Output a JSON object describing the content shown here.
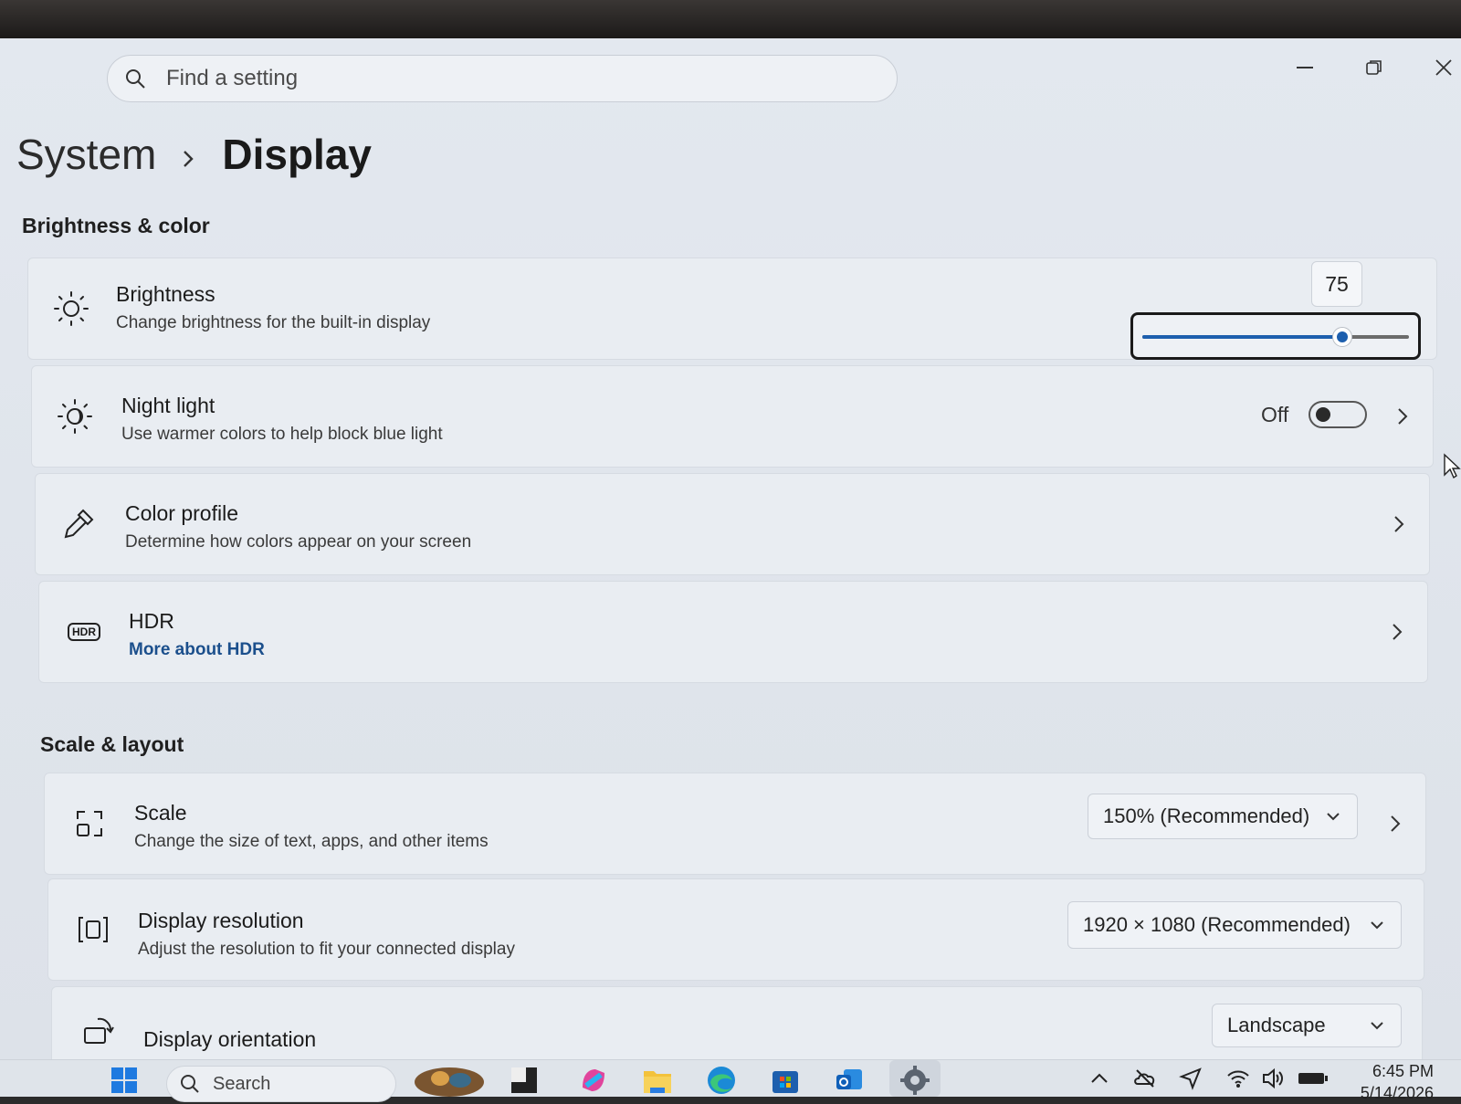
{
  "window": {
    "search_placeholder": "Find a setting",
    "controls": [
      "minimize",
      "restore",
      "close"
    ]
  },
  "breadcrumb": {
    "parent": "System",
    "separator": "›",
    "current": "Display"
  },
  "sections": {
    "brightness_color": "Brightness & color",
    "scale_layout": "Scale & layout"
  },
  "brightness": {
    "title": "Brightness",
    "subtitle": "Change brightness for the built-in display",
    "value": 75,
    "value_label": "75",
    "icon": "sun-icon"
  },
  "night_light": {
    "title": "Night light",
    "subtitle": "Use warmer colors to help block blue light",
    "state_label": "Off",
    "enabled": false,
    "icon": "night-light-icon"
  },
  "color_profile": {
    "title": "Color profile",
    "subtitle": "Determine how colors appear on your screen",
    "icon": "eyedropper-icon"
  },
  "hdr": {
    "title": "HDR",
    "link": "More about HDR",
    "icon_text": "HDR",
    "icon": "hdr-icon"
  },
  "scale": {
    "title": "Scale",
    "subtitle": "Change the size of text, apps, and other items",
    "selected": "150% (Recommended)",
    "icon": "scale-icon"
  },
  "resolution": {
    "title": "Display resolution",
    "subtitle": "Adjust the resolution to fit your connected display",
    "selected": "1920 × 1080 (Recommended)",
    "icon": "resolution-icon"
  },
  "orientation": {
    "title": "Display orientation",
    "selected": "Landscape",
    "icon": "orientation-icon"
  },
  "taskbar": {
    "search_label": "Search",
    "apps": [
      "start-icon",
      "game-icon",
      "terminal-icon",
      "copilot-icon",
      "file-explorer-icon",
      "edge-icon",
      "store-icon",
      "outlook-icon",
      "settings-icon"
    ],
    "tray": [
      "chevron-up-icon",
      "onedrive-icon",
      "location-icon",
      "wifi-icon",
      "volume-icon",
      "battery-icon"
    ],
    "time": "6:45 PM",
    "date": "5/14/2026"
  },
  "colors": {
    "accent": "#1d5fae",
    "link": "#1b4f8c",
    "window_bg": "#e3e8ef",
    "card_bg": "#e9edf2"
  }
}
